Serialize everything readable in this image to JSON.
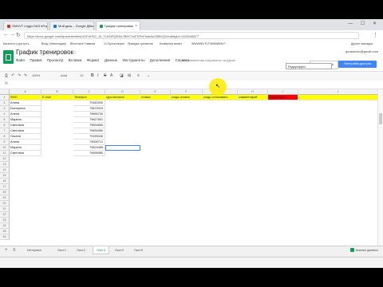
{
  "browser": {
    "tabs": [
      {
        "label": "GMVVT студи ОАЛ в: пр",
        "color": "#d93025"
      },
      {
        "label": "Мой диск – Google Диск",
        "color": "#1a73e8"
      },
      {
        "label": "График тренировок",
        "color": "#0f9d58"
      }
    ],
    "url": "https://docs.google.com/spreadsheets/d/1PnHSC_M_TLkDIRQRNx7BHCSuFDPnFbdaAuGBB1Q0/edit#gid=1428168677",
    "bookmarks": [
      "Каталоги и доступ к...",
      "Вход | Мессенджер",
      "ВКонтакте  Главная",
      "1С:Бухгалтерия",
      "Ярмарка тренингов",
      "Конвертер валют",
      "WWWWN FLT/WWWWN F..."
    ],
    "bookmarks_right": "Другие закладки",
    "window_controls": "— ☐ ✕"
  },
  "sheets": {
    "title": "График тренировок",
    "menu": [
      "Файл",
      "Правка",
      "Просмотр",
      "Вставка",
      "Формат",
      "Данные",
      "Инструменты",
      "Дополнения",
      "Справка"
    ],
    "saved_status": "Все изменения сохранены на Диске",
    "user_email": "gorasenko@gmail.com",
    "comments_label": "Комментарии",
    "share_label": "Настройки доступа",
    "toolbar_icons": [
      "print-icon",
      "undo-icon",
      "redo-icon",
      "paint-format-icon"
    ],
    "toolbar_zoom": "100%",
    "toolbar_font": "Arial",
    "toolbar_font_size": "10",
    "fx_label": "fx",
    "namebox_value": "Радиусфрез"
  },
  "grid": {
    "columns": [
      "A",
      "B",
      "C",
      "D",
      "E",
      "F",
      "G",
      "H",
      "I",
      "J"
    ],
    "header_row": [
      "ФИО",
      "E-mail",
      "Телефон",
      "курс/занятия",
      "ставка",
      "когда оплата",
      "когда оплачивать",
      "комментарий",
      "Радиусфрез",
      ""
    ],
    "rows": [
      {
        "name": "Алина",
        "phone": "79160390"
      },
      {
        "name": "Екатерина",
        "phone": "79679315"
      },
      {
        "name": "Алена",
        "phone": "79696730"
      },
      {
        "name": "Марина",
        "phone": "79627801"
      },
      {
        "name": "Светлана",
        "phone": "79694865"
      },
      {
        "name": "Светлана",
        "phone": "79639480"
      },
      {
        "name": "Оксана",
        "phone": "79190026"
      },
      {
        "name": "Алина",
        "phone": "79006712"
      },
      {
        "name": "Марина",
        "phone": "79624465"
      },
      {
        "name": "Светлана",
        "phone": "79695980"
      }
    ],
    "empty_row_numbers": [
      12,
      13,
      14,
      15,
      16,
      17,
      18,
      19,
      20,
      21,
      22,
      23,
      24,
      25,
      26
    ]
  },
  "sheet_tabs": {
    "tabs": [
      "Лист1",
      "Лист2",
      "Лист3",
      "Лист4",
      "Лист5"
    ],
    "active_index": 2,
    "first_label": "Интервал",
    "explore_label": "Анализ данных"
  }
}
